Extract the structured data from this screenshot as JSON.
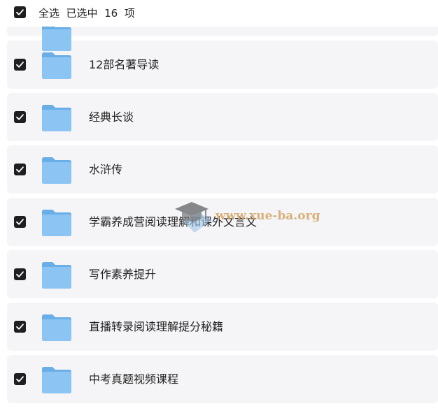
{
  "header": {
    "label": "全选  已选中  16  项"
  },
  "items": [
    {
      "name": "12部名著导读"
    },
    {
      "name": "经典长谈"
    },
    {
      "name": "水浒传"
    },
    {
      "name": "学霸养成营阅读理解和课外文言文"
    },
    {
      "name": "写作素养提升"
    },
    {
      "name": "直播转录阅读理解提分秘籍"
    },
    {
      "name": "中考真题视频课程"
    }
  ],
  "watermark": {
    "text": "www.xue-ba.org"
  },
  "colors": {
    "row_bg": "#f5f5f7",
    "folder": "#7fbcf0",
    "checkbox": "#1f1f1f",
    "watermark": "#d4a566"
  },
  "icons": {
    "checkbox": "check-icon",
    "folder": "folder-icon",
    "watermark": "graduation-cap-icon"
  }
}
